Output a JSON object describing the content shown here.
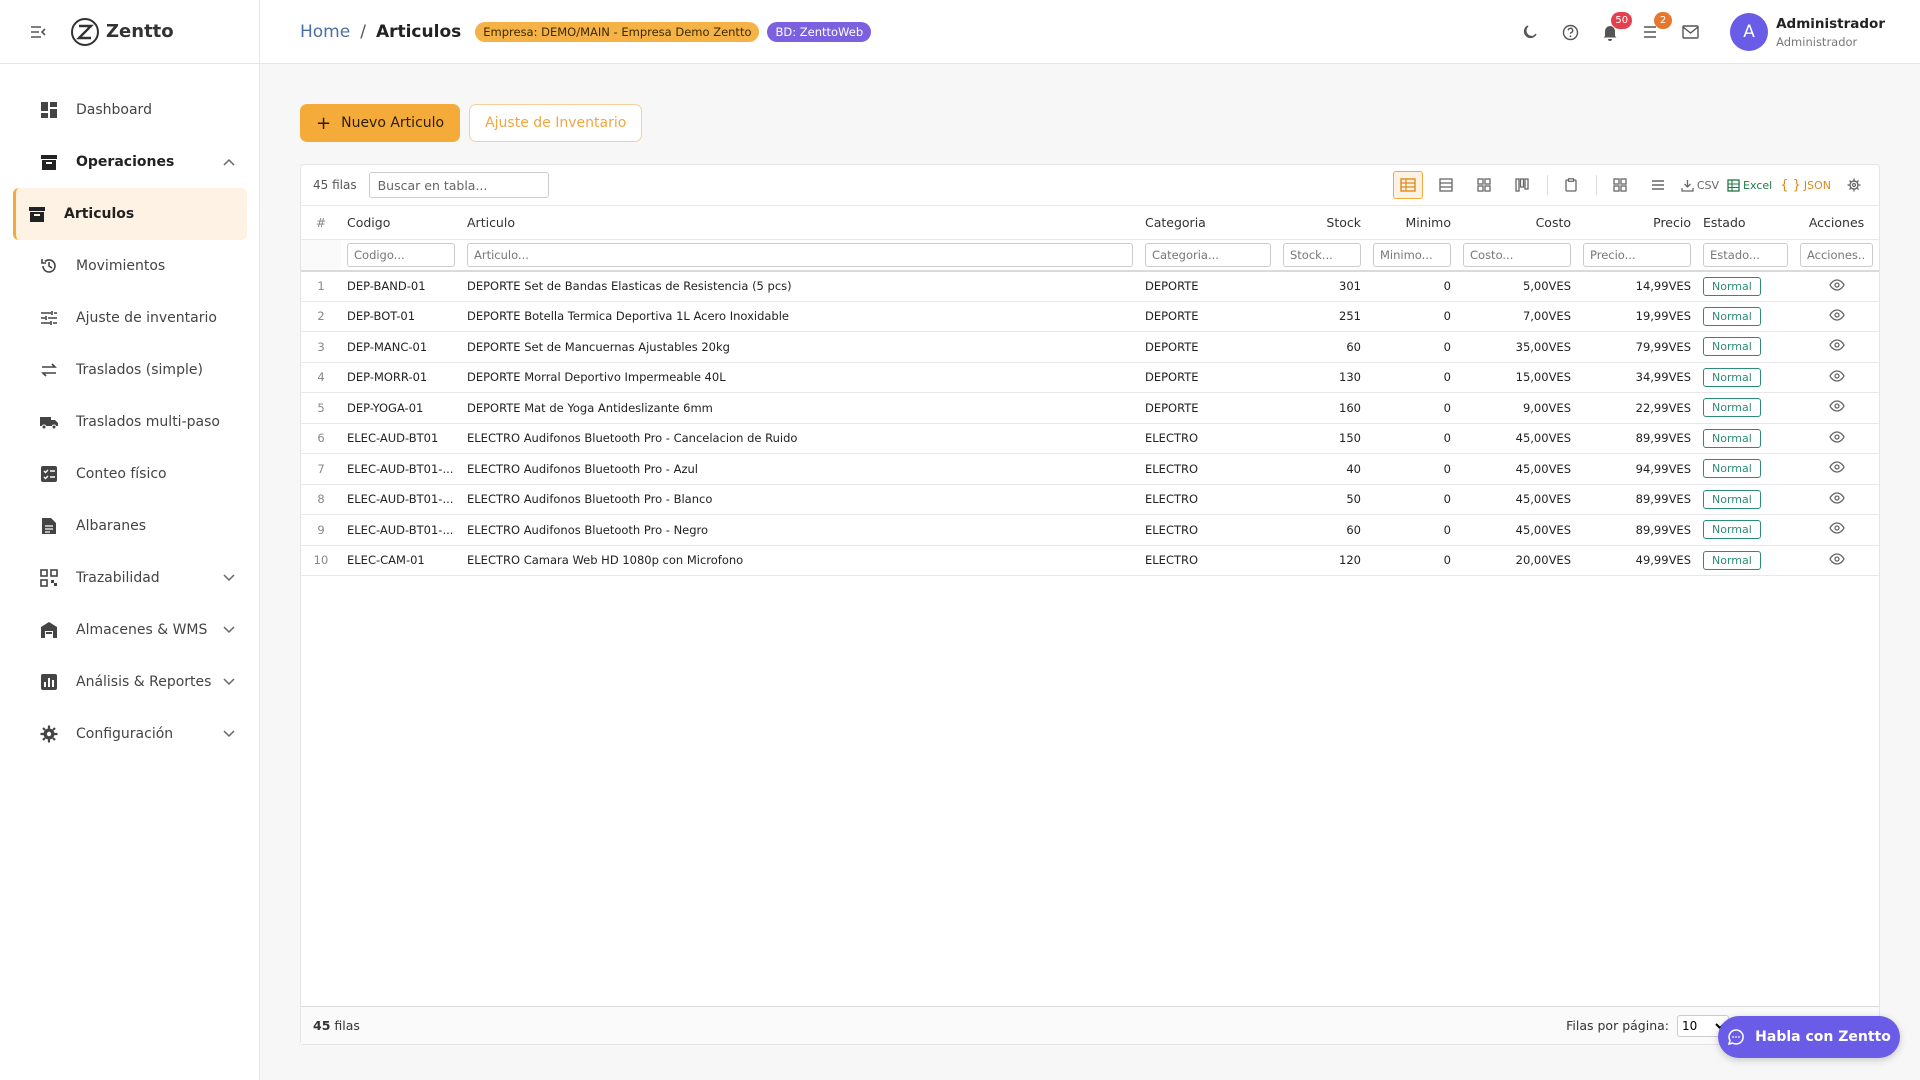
{
  "brand": {
    "name": "Zentto"
  },
  "sidebar": {
    "items": [
      {
        "label": "Dashboard",
        "icon": "dashboard-icon"
      },
      {
        "label": "Operaciones",
        "icon": "archive-icon"
      },
      {
        "label": "Articulos",
        "icon": "archive-icon"
      },
      {
        "label": "Movimientos",
        "icon": "history-icon"
      },
      {
        "label": "Ajuste de inventario",
        "icon": "sliders-icon"
      },
      {
        "label": "Traslados (simple)",
        "icon": "swap-icon"
      },
      {
        "label": "Traslados multi-paso",
        "icon": "truck-icon"
      },
      {
        "label": "Conteo físico",
        "icon": "checklist-icon"
      },
      {
        "label": "Albaranes",
        "icon": "document-icon"
      },
      {
        "label": "Trazabilidad",
        "icon": "qr-code-icon"
      },
      {
        "label": "Almacenes & WMS",
        "icon": "warehouse-icon"
      },
      {
        "label": "Análisis & Reportes",
        "icon": "bar-chart-icon"
      },
      {
        "label": "Configuración",
        "icon": "gear-icon"
      }
    ]
  },
  "header": {
    "breadcrumb": {
      "home": "Home",
      "sep": "/",
      "current": "Articulos"
    },
    "empresa_chip": "Empresa: DEMO/MAIN - Empresa Demo Zentto",
    "bd_chip": "BD: ZenttoWeb",
    "notifications_count": "50",
    "tasks_count": "2",
    "user": {
      "initial": "A",
      "name": "Administrador",
      "role": "Administrador"
    }
  },
  "actions": {
    "new_label": "Nuevo Articulo",
    "adjust_label": "Ajuste de Inventario"
  },
  "grid": {
    "row_count_label": "45 filas",
    "search_placeholder": "Buscar en tabla...",
    "tools": {
      "csv": "CSV",
      "excel": "Excel",
      "json": "JSON"
    },
    "columns": [
      "#",
      "Codigo",
      "Articulo",
      "Categoria",
      "Stock",
      "Minimo",
      "Costo",
      "Precio",
      "Estado",
      "Acciones"
    ],
    "filters": [
      "Codigo...",
      "Articulo...",
      "Categoria...",
      "Stock...",
      "Minimo...",
      "Costo...",
      "Precio...",
      "Estado...",
      "Acciones..."
    ],
    "rows": [
      {
        "idx": "1",
        "codigo": "DEP-BAND-01",
        "articulo": "DEPORTE Set de Bandas Elasticas de Resistencia (5 pcs)",
        "categoria": "DEPORTE",
        "stock": "301",
        "minimo": "0",
        "costo": "5,00VES",
        "precio": "14,99VES",
        "estado": "Normal"
      },
      {
        "idx": "2",
        "codigo": "DEP-BOT-01",
        "articulo": "DEPORTE Botella Termica Deportiva 1L Acero Inoxidable",
        "categoria": "DEPORTE",
        "stock": "251",
        "minimo": "0",
        "costo": "7,00VES",
        "precio": "19,99VES",
        "estado": "Normal"
      },
      {
        "idx": "3",
        "codigo": "DEP-MANC-01",
        "articulo": "DEPORTE Set de Mancuernas Ajustables 20kg",
        "categoria": "DEPORTE",
        "stock": "60",
        "minimo": "0",
        "costo": "35,00VES",
        "precio": "79,99VES",
        "estado": "Normal"
      },
      {
        "idx": "4",
        "codigo": "DEP-MORR-01",
        "articulo": "DEPORTE Morral Deportivo Impermeable 40L",
        "categoria": "DEPORTE",
        "stock": "130",
        "minimo": "0",
        "costo": "15,00VES",
        "precio": "34,99VES",
        "estado": "Normal"
      },
      {
        "idx": "5",
        "codigo": "DEP-YOGA-01",
        "articulo": "DEPORTE Mat de Yoga Antideslizante 6mm",
        "categoria": "DEPORTE",
        "stock": "160",
        "minimo": "0",
        "costo": "9,00VES",
        "precio": "22,99VES",
        "estado": "Normal"
      },
      {
        "idx": "6",
        "codigo": "ELEC-AUD-BT01",
        "articulo": "ELECTRO Audifonos Bluetooth Pro - Cancelacion de Ruido",
        "categoria": "ELECTRO",
        "stock": "150",
        "minimo": "0",
        "costo": "45,00VES",
        "precio": "89,99VES",
        "estado": "Normal"
      },
      {
        "idx": "7",
        "codigo": "ELEC-AUD-BT01-...",
        "articulo": "ELECTRO Audifonos Bluetooth Pro - Azul",
        "categoria": "ELECTRO",
        "stock": "40",
        "minimo": "0",
        "costo": "45,00VES",
        "precio": "94,99VES",
        "estado": "Normal"
      },
      {
        "idx": "8",
        "codigo": "ELEC-AUD-BT01-...",
        "articulo": "ELECTRO Audifonos Bluetooth Pro - Blanco",
        "categoria": "ELECTRO",
        "stock": "50",
        "minimo": "0",
        "costo": "45,00VES",
        "precio": "89,99VES",
        "estado": "Normal"
      },
      {
        "idx": "9",
        "codigo": "ELEC-AUD-BT01-...",
        "articulo": "ELECTRO Audifonos Bluetooth Pro - Negro",
        "categoria": "ELECTRO",
        "stock": "60",
        "minimo": "0",
        "costo": "45,00VES",
        "precio": "89,99VES",
        "estado": "Normal"
      },
      {
        "idx": "10",
        "codigo": "ELEC-CAM-01",
        "articulo": "ELECTRO Camara Web HD 1080p con Microfono",
        "categoria": "ELECTRO",
        "stock": "120",
        "minimo": "0",
        "costo": "20,00VES",
        "precio": "49,99VES",
        "estado": "Normal"
      }
    ],
    "footer": {
      "count": "45",
      "count_suffix": "filas",
      "per_page_label": "Filas por página:",
      "per_page_value": "10"
    }
  },
  "chat": {
    "label": "Habla con Zentto"
  },
  "colors": {
    "accent": "#f5ab3a",
    "brand_purple": "#6b5ce7",
    "status_green": "#2e8b77"
  }
}
